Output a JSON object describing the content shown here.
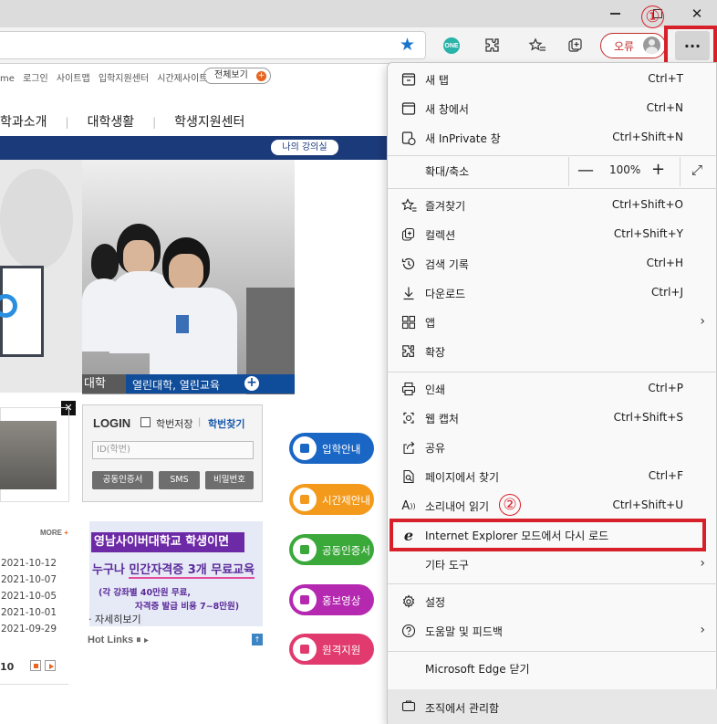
{
  "window": {
    "minimize_icon": "minimize-icon",
    "maximize_icon": "restore-icon",
    "close_glyph": "✕"
  },
  "toolbar": {
    "error_label": "오류",
    "more_label": "···",
    "one_badge": "ONE"
  },
  "annotations": {
    "step1": "①",
    "step2": "②"
  },
  "site": {
    "top_links": [
      "me",
      "로그인",
      "사이트맵",
      "입학지원센터",
      "시간제사이트"
    ],
    "all_view": "전체보기",
    "all_view_plus": "+",
    "main_nav": [
      "학과소개",
      "대학생활",
      "학생지원센터"
    ],
    "my_lecture": "나의 강의실",
    "hero_dark": "대학",
    "hero_slogan": "열린대학, 열린교육",
    "hero_plus": "+",
    "close_x": "✕",
    "login": {
      "title": "LOGIN",
      "save_id": "학번저장",
      "separator": "|",
      "find_id": "학번찾기",
      "id_placeholder": "ID(학번)",
      "btn_cert": "공동인증서",
      "btn_sms": "SMS",
      "btn_pw": "비밀번호"
    },
    "pills": [
      "입학안내",
      "시간제안내",
      "공동인증서",
      "홍보영상",
      "원격지원"
    ],
    "more": "MORE",
    "more_plus": "+",
    "dates": [
      "2021-10-12",
      "2021-10-07",
      "2021-10-05",
      "2021-10-01",
      "2021-09-29"
    ],
    "page_num": "10",
    "banner": {
      "head": "영남사이버대학교 학생이면",
      "main_prefix": "누구나 ",
      "main_highlight": "민간자격증 3개 무료교육",
      "sub1": "(각 강좌별 40만원 무료,",
      "sub2": "자격증 발급 비용 7~8만원)"
    },
    "banner_more": "· 자세히보기",
    "hot_links": "Hot Links ⏸ ▸",
    "hot_links_top": "↑"
  },
  "menu": {
    "new_tab": {
      "label": "새 탭",
      "shortcut": "Ctrl+T"
    },
    "new_window": {
      "label": "새 창에서",
      "shortcut": "Ctrl+N"
    },
    "new_inprivate": {
      "label": "새 InPrivate 창",
      "shortcut": "Ctrl+Shift+N"
    },
    "zoom": {
      "label": "확대/축소",
      "minus": "—",
      "value": "100%",
      "plus": "+",
      "full": "⤢"
    },
    "favorites": {
      "label": "즐겨찾기",
      "shortcut": "Ctrl+Shift+O"
    },
    "collections": {
      "label": "컬렉션",
      "shortcut": "Ctrl+Shift+Y"
    },
    "history": {
      "label": "검색 기록",
      "shortcut": "Ctrl+H"
    },
    "downloads": {
      "label": "다운로드",
      "shortcut": "Ctrl+J"
    },
    "apps": {
      "label": "앱",
      "chevron": "›"
    },
    "extensions": {
      "label": "확장"
    },
    "print": {
      "label": "인쇄",
      "shortcut": "Ctrl+P"
    },
    "web_capture": {
      "label": "웹 캡처",
      "shortcut": "Ctrl+Shift+S"
    },
    "share": {
      "label": "공유"
    },
    "find": {
      "label": "페이지에서 찾기",
      "shortcut": "Ctrl+F"
    },
    "read_aloud": {
      "label": "소리내어 읽기",
      "shortcut": "Ctrl+Shift+U"
    },
    "ie_mode": {
      "label": "Internet Explorer 모드에서 다시 로드",
      "icon_glyph": "e"
    },
    "more_tools": {
      "label": "기타 도구",
      "chevron": "›"
    },
    "settings": {
      "label": "설정"
    },
    "help": {
      "label": "도움말 및 피드백",
      "chevron": "›"
    },
    "close_edge": {
      "label": "Microsoft Edge 닫기"
    },
    "managed": {
      "label": "조직에서 관리함"
    }
  }
}
